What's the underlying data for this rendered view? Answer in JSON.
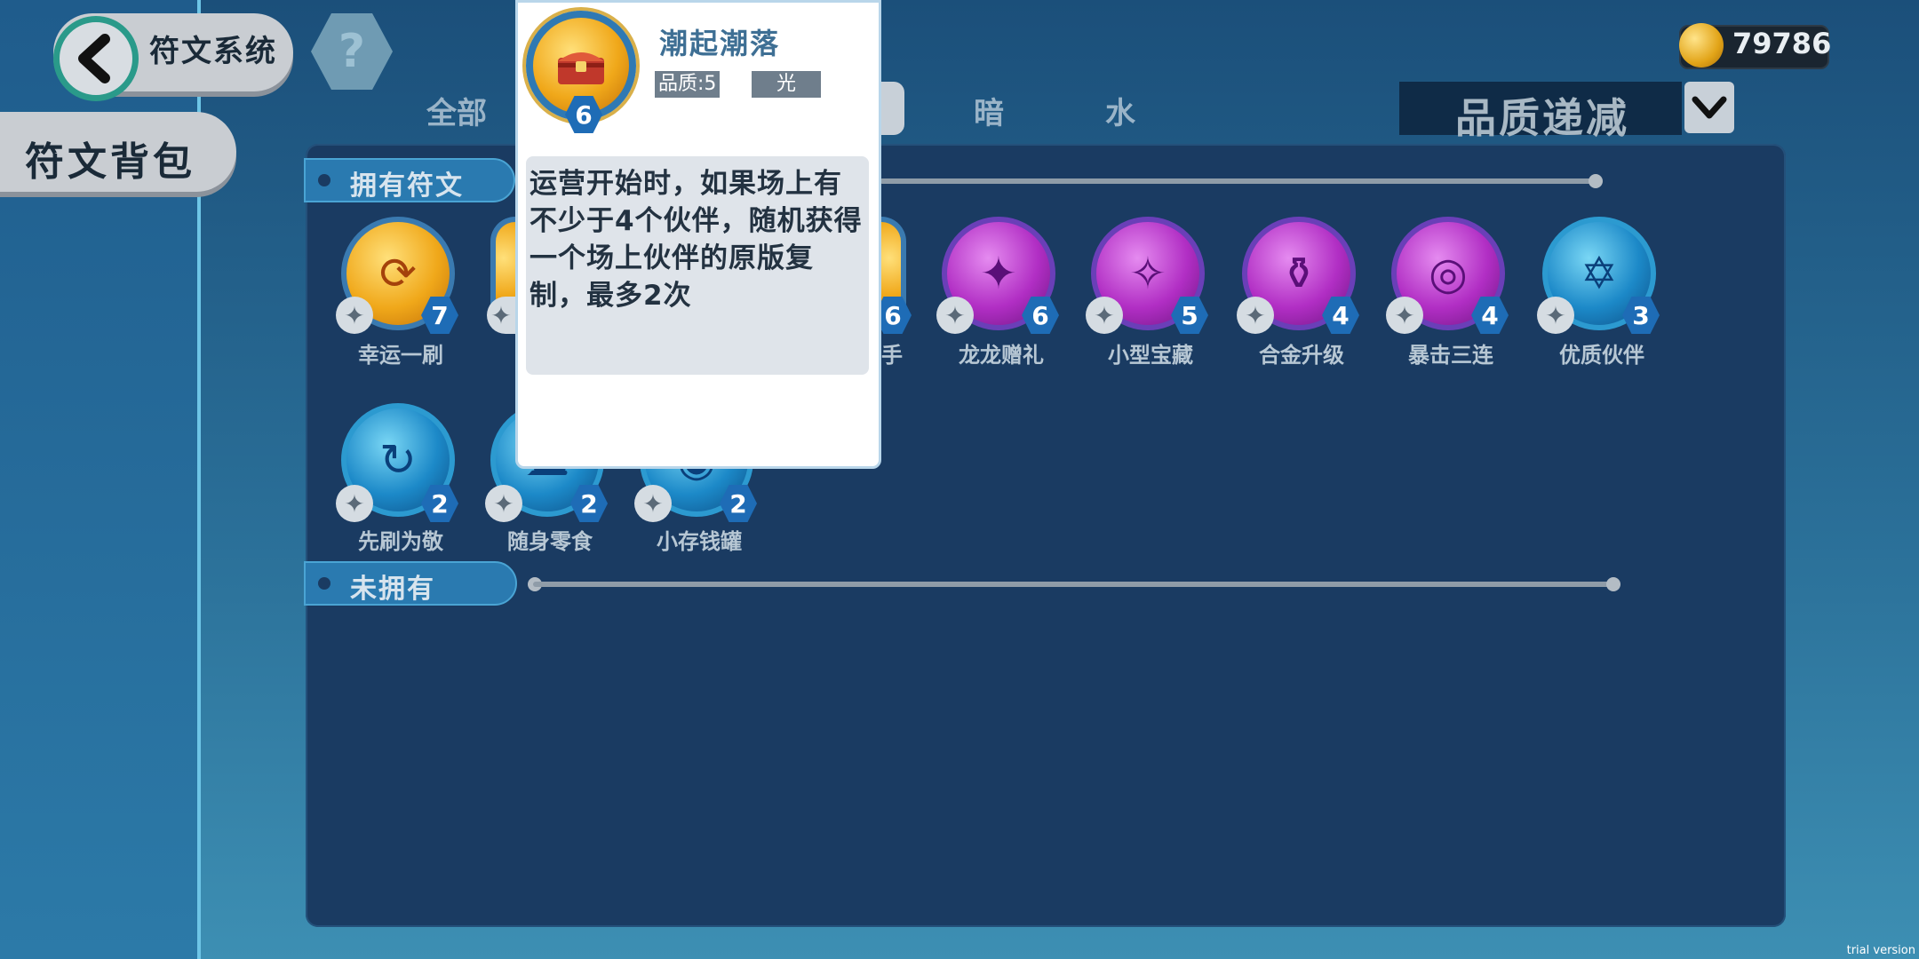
{
  "header": {
    "title": "符文系统",
    "help_glyph": "?",
    "back_icon": "chevron-left-icon"
  },
  "sidebar": {
    "bag_label": "符文背包"
  },
  "tabs": [
    {
      "label": "全部"
    },
    {
      "label": "暗"
    },
    {
      "label": "水"
    }
  ],
  "currency": {
    "amount": "79786",
    "icon": "gold-coin-icon"
  },
  "sort": {
    "label": "品质递减",
    "icon": "chevron-down-icon"
  },
  "sections": {
    "owned": "拥有符文",
    "not_owned": "未拥有"
  },
  "runes_row1": [
    {
      "name": "幸运一刷",
      "level": "7",
      "color": "gold",
      "glyph": "⟳"
    },
    {
      "name": "龙龙赠礼",
      "level": "6",
      "color": "purple",
      "glyph": "✦"
    },
    {
      "name": "小型宝藏",
      "level": "5",
      "color": "purple",
      "glyph": "✧"
    },
    {
      "name": "合金升级",
      "level": "4",
      "color": "purple",
      "glyph": "⚱"
    },
    {
      "name": "暴击三连",
      "level": "4",
      "color": "purple",
      "glyph": "◎"
    },
    {
      "name": "优质伙伴",
      "level": "3",
      "color": "blue",
      "glyph": "✡"
    }
  ],
  "runes_partial": [
    {
      "name_fragment": "手",
      "level": "6"
    }
  ],
  "runes_row2": [
    {
      "name": "先刷为敬",
      "level": "2",
      "color": "blue",
      "glyph": "↻"
    },
    {
      "name": "随身零食",
      "level": "2",
      "color": "blue",
      "glyph": "☁"
    },
    {
      "name": "小存钱罐",
      "level": "2",
      "color": "blue",
      "glyph": "◉"
    }
  ],
  "tooltip": {
    "title": "潮起潮落",
    "quality": "品质:5",
    "element": "光",
    "level": "6",
    "icon": "treasure-chest-icon",
    "description": "运营开始时，如果场上有不少于4个伙伴，随机获得一个场上伙伴的原版复制，最多2次"
  },
  "watermark": "trial version"
}
